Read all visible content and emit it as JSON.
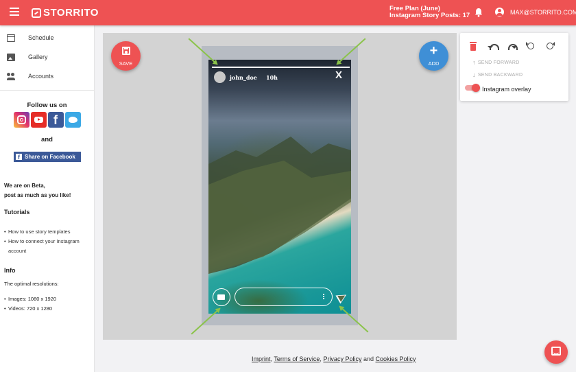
{
  "app": {
    "name": "STORRITO"
  },
  "header": {
    "plan_line1": "Free Plan (June)",
    "plan_line2": "Instagram Story Posts: 17",
    "email": "MAX@STORRITO.COM"
  },
  "sidebar": {
    "items": [
      {
        "label": "Schedule",
        "icon": "calendar-icon"
      },
      {
        "label": "Gallery",
        "icon": "image-icon"
      },
      {
        "label": "Accounts",
        "icon": "people-icon"
      }
    ],
    "follow_label": "Follow us on",
    "and_label": "and",
    "share_label": "Share on Facebook",
    "beta_line1": "We are on Beta,",
    "beta_line2": "post as much as you like!",
    "tutorials_title": "Tutorials",
    "tutorials": [
      "How to use story templates",
      "How to connect your Instagram account"
    ],
    "info_title": "Info",
    "info_text": "The optimal resolutions:",
    "resolutions": [
      "Images: 1080 x 1920",
      "Videos: 720 x 1280"
    ]
  },
  "editor": {
    "save_label": "SAVE",
    "add_label": "ADD",
    "story": {
      "username": "john_doe",
      "time": "10h",
      "close": "X"
    }
  },
  "panel": {
    "send_forward": "SEND FORWARD",
    "send_backward": "SEND BACKWARD",
    "overlay_label": "Instagram overlay",
    "overlay_on": true
  },
  "footer": {
    "imprint": "Imprint",
    "sep1": ",",
    "terms": "Terms of Service",
    "sep2": ",",
    "privacy": "Privacy Policy",
    "and": "and",
    "cookies": "Cookies Policy"
  },
  "colors": {
    "brand": "#ee5253",
    "add": "#3f8fd6",
    "handle": "#8bc34a",
    "facebook": "#3b5998"
  }
}
